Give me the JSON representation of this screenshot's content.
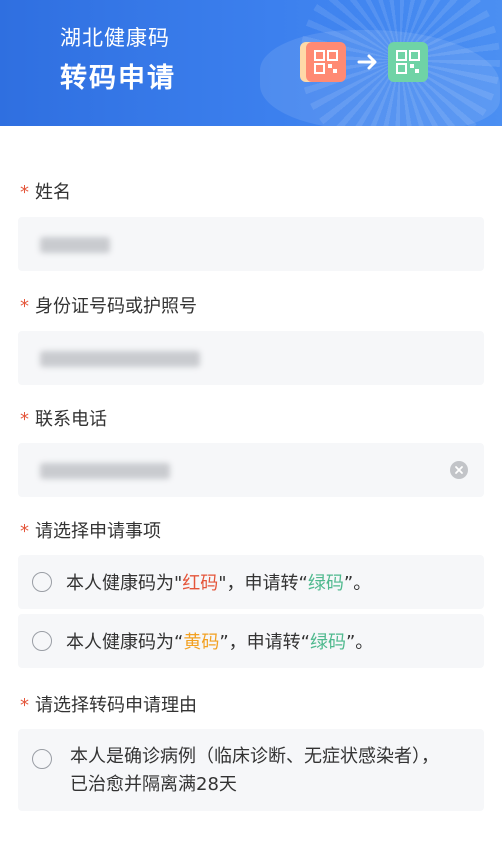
{
  "header": {
    "subtitle": "湖北健康码",
    "title": "转码申请"
  },
  "colors": {
    "header_blue": "#3578e5",
    "required_star": "#e4553a",
    "red": "#e4553a",
    "yellow": "#f2a123",
    "green": "#4fb98e"
  },
  "form": {
    "name": {
      "label": "姓名",
      "required": "*"
    },
    "id_number": {
      "label": "身份证号码或护照号",
      "required": "*"
    },
    "phone": {
      "label": "联系电话",
      "required": "*"
    },
    "matter": {
      "label": "请选择申请事项",
      "required": "*",
      "options": [
        {
          "prefix": "本人健康码为\"",
          "from": "红码",
          "middle": "\"，申请转“",
          "to": "绿码",
          "suffix": "”。"
        },
        {
          "prefix": "本人健康码为“",
          "from": "黄码",
          "middle": "”，申请转“",
          "to": "绿码",
          "suffix": "”。"
        }
      ]
    },
    "reason": {
      "label": "请选择转码申请理由",
      "required": "*",
      "options": [
        {
          "text": "本人是确诊病例（临床诊断、无症状感染者），已治愈并隔离满28天"
        }
      ]
    }
  }
}
